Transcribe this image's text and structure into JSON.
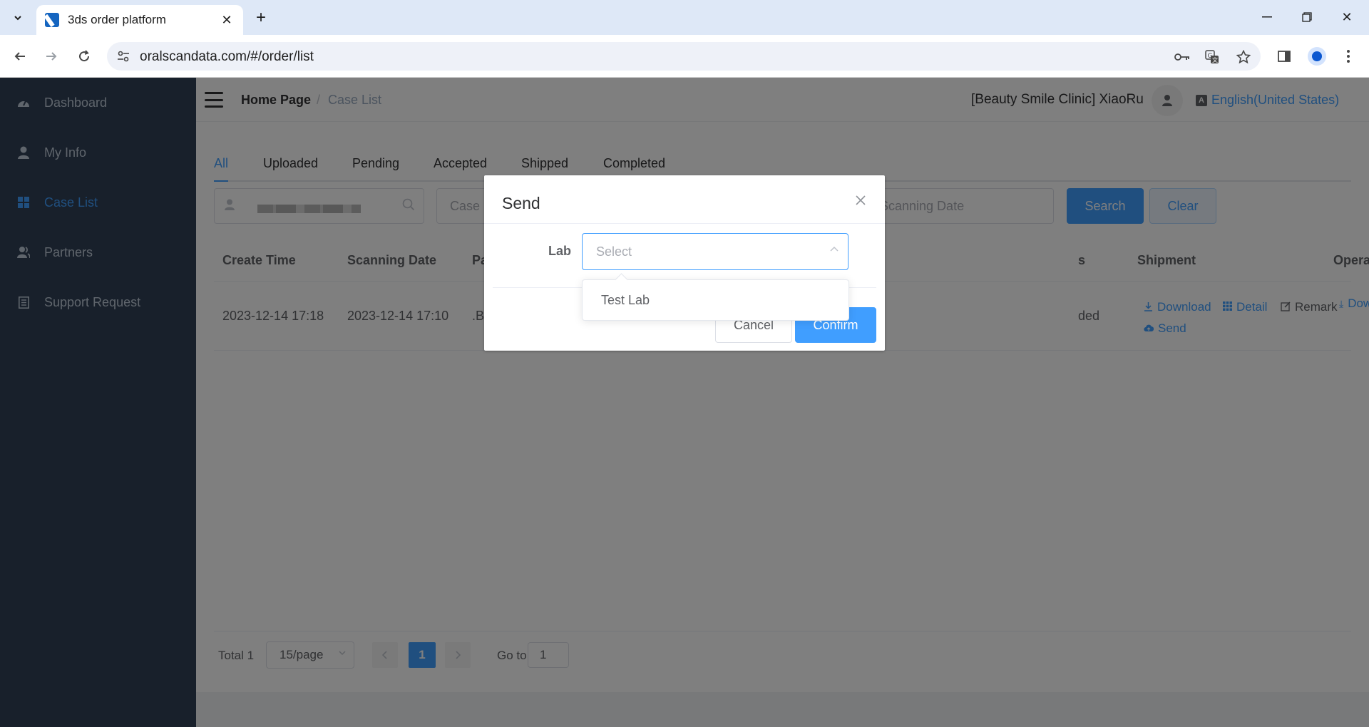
{
  "browser": {
    "tab_title": "3ds order platform",
    "url": "oralscandata.com/#/order/list"
  },
  "sidebar": {
    "items": [
      {
        "label": "Dashboard",
        "icon": "dashboard-icon"
      },
      {
        "label": "My Info",
        "icon": "user-icon"
      },
      {
        "label": "Case List",
        "icon": "grid-icon",
        "active": true
      },
      {
        "label": "Partners",
        "icon": "partners-icon"
      },
      {
        "label": "Support Request",
        "icon": "clipboard-icon"
      }
    ]
  },
  "navbar": {
    "breadcrumb_home": "Home Page",
    "breadcrumb_separator": "/",
    "breadcrumb_current": "Case List",
    "user_name": "[Beauty Smile Clinic] XiaoRu",
    "language": "English(United States)"
  },
  "tabs": [
    "All",
    "Uploaded",
    "Pending",
    "Accepted",
    "Shipped",
    "Completed"
  ],
  "filters": {
    "case_placeholder": "Case",
    "scanning_date_placeholder": "Scanning Date",
    "search_label": "Search",
    "clear_label": "Clear"
  },
  "table": {
    "headers": {
      "create_time": "Create Time",
      "scanning_date": "Scanning Date",
      "patient_partial": "Pa",
      "status_partial": "s",
      "shipment": "Shipment",
      "operation": "Operation"
    },
    "rows": [
      {
        "create_time": "2023-12-14 17:18",
        "scanning_date": "2023-12-14 17:10",
        "patient_partial": ".B",
        "status_partial": "ded",
        "shipment": ""
      }
    ],
    "operations": {
      "download": "Download",
      "detail": "Detail",
      "remark": "Remark",
      "send": "Send"
    }
  },
  "pagination": {
    "total": "Total 1",
    "page_size": "15/page",
    "current_page": "1",
    "goto_label": "Go to",
    "goto_value": "1"
  },
  "dialog": {
    "title": "Send",
    "lab_label": "Lab",
    "select_placeholder": "Select",
    "cancel_label": "Cancel",
    "confirm_label": "Confirm",
    "options": [
      "Test Lab"
    ]
  },
  "colors": {
    "primary": "#409eff",
    "sidebar_bg": "#304156",
    "browser_tabbar": "#dee8f7"
  }
}
